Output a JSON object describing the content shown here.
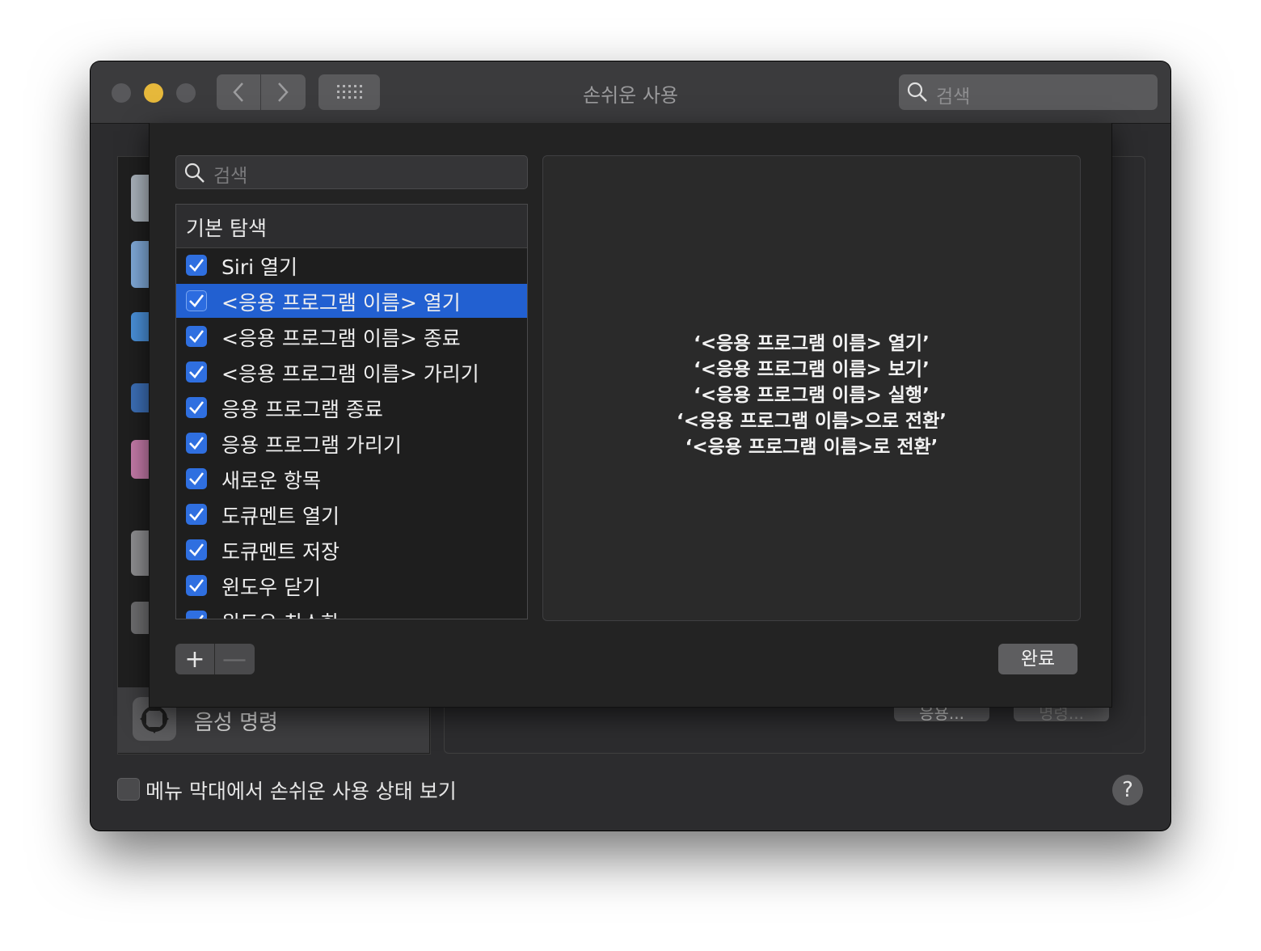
{
  "window": {
    "title": "손쉬운 사용",
    "search_placeholder": "검색"
  },
  "background": {
    "selected_item_label": "음성 명령",
    "button_1": "응용...",
    "button_2": "명령...",
    "footer_checkbox_label": "메뉴 막대에서 손쉬운 사용 상태 보기",
    "footer_checked": false,
    "help_label": "?"
  },
  "sheet": {
    "search_placeholder": "검색",
    "list_header": "기본 탐색",
    "rows": [
      {
        "label": "Siri 열기",
        "checked": true
      },
      {
        "label": "<응용 프로그램 이름> 열기",
        "checked": true,
        "selected": true
      },
      {
        "label": "<응용 프로그램 이름> 종료",
        "checked": true
      },
      {
        "label": "<응용 프로그램 이름> 가리기",
        "checked": true
      },
      {
        "label": "응용 프로그램 종료",
        "checked": true
      },
      {
        "label": "응용 프로그램 가리기",
        "checked": true
      },
      {
        "label": "새로운 항목",
        "checked": true
      },
      {
        "label": "도큐멘트 열기",
        "checked": true
      },
      {
        "label": "도큐멘트 저장",
        "checked": true
      },
      {
        "label": "윈도우 닫기",
        "checked": true
      },
      {
        "label": "윈도우 최소화",
        "checked": true
      }
    ],
    "detail_lines": [
      "‘<응용 프로그램 이름> 열기’",
      "‘<응용 프로그램 이름> 보기’",
      "‘<응용 프로그램 이름> 실행’",
      "‘<응용 프로그램 이름>으로 전환’",
      "‘<응용 프로그램 이름>로 전환’"
    ],
    "add_label": "+",
    "remove_label": "—",
    "done_label": "완료"
  },
  "colors": {
    "accent": "#2260d1",
    "checkbox": "#2f6fe0",
    "traffic_yellow": "#e6b83b"
  }
}
